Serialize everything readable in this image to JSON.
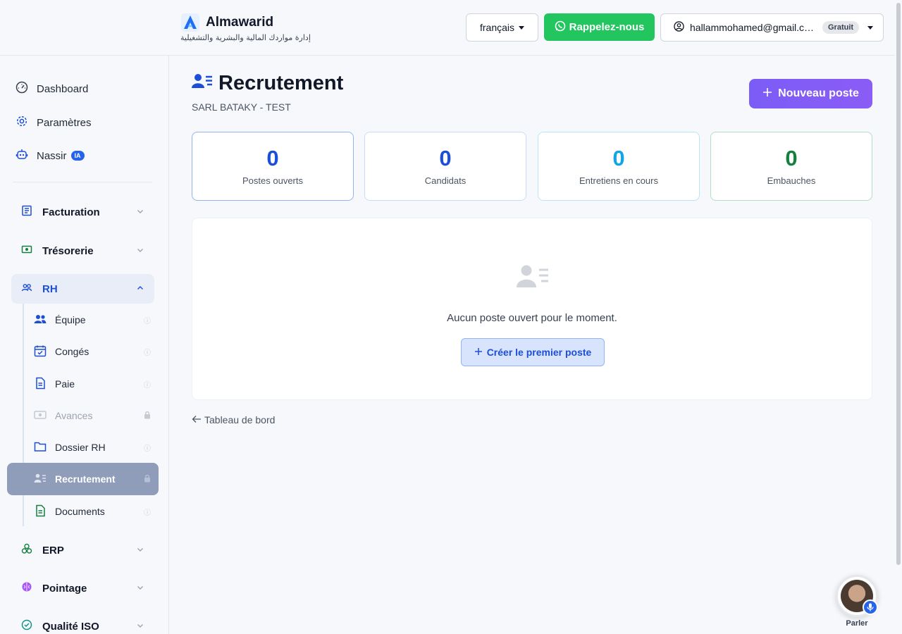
{
  "header": {
    "brand_name": "Almawarid",
    "brand_tagline": "إدارة مواردك المالية والبشرية والتشغيلية",
    "language": "français",
    "callback_label": "Rappelez-nous",
    "user_email": "hallammohamed@gmail.c…",
    "plan_badge": "Gratuit"
  },
  "sidebar": {
    "top_items": [
      {
        "label": "Dashboard",
        "icon": "gauge-icon"
      },
      {
        "label": "Paramètres",
        "icon": "gear-icon"
      },
      {
        "label": "Nassir",
        "icon": "robot-icon",
        "badge": "IA"
      }
    ],
    "groups": [
      {
        "label": "Facturation",
        "icon": "invoice-icon"
      },
      {
        "label": "Trésorerie",
        "icon": "cash-icon"
      },
      {
        "label": "RH",
        "icon": "people-icon"
      },
      {
        "label": "ERP",
        "icon": "cubes-icon"
      },
      {
        "label": "Pointage",
        "icon": "brain-icon"
      },
      {
        "label": "Qualité ISO",
        "icon": "check-circle-icon"
      }
    ],
    "rh_items": [
      {
        "label": "Équipe",
        "icon": "team-icon",
        "trail": "info-icon"
      },
      {
        "label": "Congés",
        "icon": "calendar-check-icon",
        "trail": "info-icon"
      },
      {
        "label": "Paie",
        "icon": "document-icon",
        "trail": "info-icon"
      },
      {
        "label": "Avances",
        "icon": "cash-icon",
        "trail": "lock-icon"
      },
      {
        "label": "Dossier RH",
        "icon": "folder-icon",
        "trail": "info-icon"
      },
      {
        "label": "Recrutement",
        "icon": "user-list-icon",
        "trail": "lock-icon"
      },
      {
        "label": "Documents",
        "icon": "file-text-icon",
        "trail": "info-icon"
      }
    ]
  },
  "main": {
    "title": "Recrutement",
    "company": "SARL BATAKY - TEST",
    "new_button": "Nouveau poste",
    "stats": [
      {
        "value": "0",
        "label": "Postes ouverts",
        "color": "#1d4ed8",
        "border": "#93b4f0"
      },
      {
        "value": "0",
        "label": "Candidats",
        "color": "#1d4ed8",
        "border": "#c9dbf7"
      },
      {
        "value": "0",
        "label": "Entretiens en cours",
        "color": "#0ea5e9",
        "border": "#b7e6f6"
      },
      {
        "value": "0",
        "label": "Embauches",
        "color": "#15803d",
        "border": "#b5dbc5"
      }
    ],
    "empty_message": "Aucun poste ouvert pour le moment.",
    "create_button": "Créer le premier poste",
    "back_link": "Tableau de bord"
  },
  "voice": {
    "label": "Parler"
  }
}
